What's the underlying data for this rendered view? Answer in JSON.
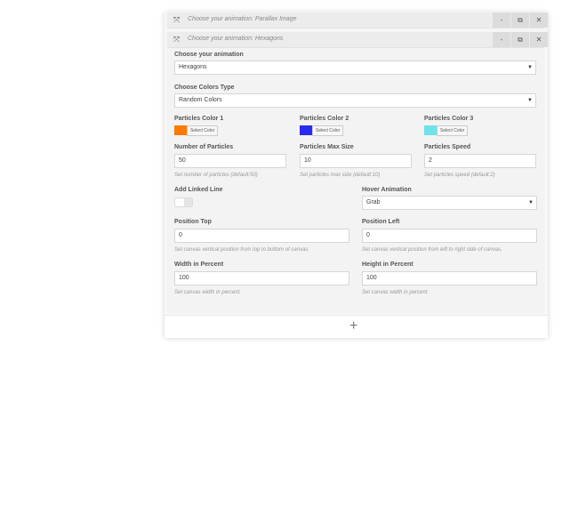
{
  "rows": [
    {
      "title": "Choose your animation: Parallax Image"
    },
    {
      "title": "Choose your animation: Hexagons"
    }
  ],
  "controls": {
    "minimize": "-",
    "duplicate": "⧉",
    "close": "✕"
  },
  "form": {
    "animation": {
      "label": "Choose your animation",
      "value": "Hexagons"
    },
    "colors_type": {
      "label": "Choose Colors Type",
      "value": "Random Colors"
    },
    "color1": {
      "label": "Particles Color 1",
      "color": "#ff7a00",
      "button": "Select Color"
    },
    "color2": {
      "label": "Particles Color 2",
      "color": "#2b2bf0",
      "button": "Select Color"
    },
    "color3": {
      "label": "Particles Color 3",
      "color": "#6ee3e8",
      "button": "Select Color"
    },
    "num_particles": {
      "label": "Number of Particles",
      "value": "50",
      "help": "Set number of particles (default:50)"
    },
    "max_size": {
      "label": "Particles Max Size",
      "value": "10",
      "help": "Set particles max size (default:10)"
    },
    "speed": {
      "label": "Particles Speed",
      "value": "2",
      "help": "Set particles speed (default:2)"
    },
    "linked_line": {
      "label": "Add Linked Line",
      "on": false
    },
    "hover": {
      "label": "Hover Animation",
      "value": "Grab"
    },
    "pos_top": {
      "label": "Position Top",
      "value": "0",
      "help": "Set canvas vertical position from top to bottom of canvas."
    },
    "pos_left": {
      "label": "Position Left",
      "value": "0",
      "help": "Set canvas vertical position from left to right side of canvas."
    },
    "width": {
      "label": "Width in Percent",
      "value": "100",
      "help": "Set canvas width in percent."
    },
    "height": {
      "label": "Height in Percent",
      "value": "100",
      "help": "Set canvas width in percent."
    }
  },
  "add": {
    "symbol": "+"
  }
}
